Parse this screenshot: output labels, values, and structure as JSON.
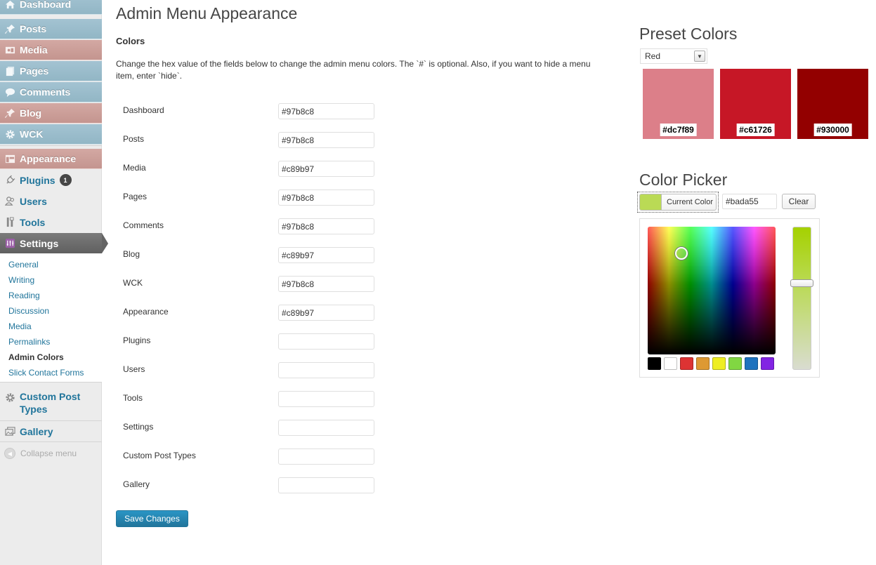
{
  "sidebar": {
    "items": [
      {
        "label": "Dashboard",
        "icon": "home-icon",
        "color": "#97b8c8"
      },
      {
        "label": "Posts",
        "icon": "pushpin-icon",
        "color": "#97b8c8"
      },
      {
        "label": "Media",
        "icon": "media-icon",
        "color": "#c89b97"
      },
      {
        "label": "Pages",
        "icon": "pages-icon",
        "color": "#97b8c8"
      },
      {
        "label": "Comments",
        "icon": "comment-icon",
        "color": "#97b8c8"
      },
      {
        "label": "Blog",
        "icon": "pushpin-icon",
        "color": "#c89b97"
      },
      {
        "label": "WCK",
        "icon": "gear-icon",
        "color": "#97b8c8"
      },
      {
        "label": "Appearance",
        "icon": "appearance-icon",
        "color": "#c89b97"
      },
      {
        "label": "Plugins",
        "icon": "plug-icon",
        "badge": "1"
      },
      {
        "label": "Users",
        "icon": "users-icon"
      },
      {
        "label": "Tools",
        "icon": "tools-icon"
      },
      {
        "label": "Settings",
        "icon": "settings-icon"
      },
      {
        "label": "Custom Post Types",
        "icon": "gear-icon"
      },
      {
        "label": "Gallery",
        "icon": "gallery-icon"
      }
    ],
    "submenu": [
      "General",
      "Writing",
      "Reading",
      "Discussion",
      "Media",
      "Permalinks",
      "Admin Colors",
      "Slick Contact Forms"
    ],
    "collapse_label": "Collapse menu"
  },
  "main": {
    "title": "Admin Menu Appearance",
    "section_title": "Colors",
    "description": "Change the hex value of the fields below to change the admin menu colors. The `#` is optional. Also, if you want to hide a menu item, enter `hide`.",
    "fields": [
      {
        "label": "Dashboard",
        "value": "#97b8c8"
      },
      {
        "label": "Posts",
        "value": "#97b8c8"
      },
      {
        "label": "Media",
        "value": "#c89b97"
      },
      {
        "label": "Pages",
        "value": "#97b8c8"
      },
      {
        "label": "Comments",
        "value": "#97b8c8"
      },
      {
        "label": "Blog",
        "value": "#c89b97"
      },
      {
        "label": "WCK",
        "value": "#97b8c8"
      },
      {
        "label": "Appearance",
        "value": "#c89b97"
      },
      {
        "label": "Plugins",
        "value": ""
      },
      {
        "label": "Users",
        "value": ""
      },
      {
        "label": "Tools",
        "value": ""
      },
      {
        "label": "Settings",
        "value": ""
      },
      {
        "label": "Custom Post Types",
        "value": ""
      },
      {
        "label": "Gallery",
        "value": ""
      }
    ],
    "save_label": "Save Changes"
  },
  "presets": {
    "title": "Preset Colors",
    "selected": "Red",
    "swatches": [
      "#dc7f89",
      "#c61726",
      "#930000"
    ]
  },
  "picker": {
    "title": "Color Picker",
    "current_color_label": "Current Color",
    "hex_value": "#bada55",
    "clear_label": "Clear",
    "palette": [
      "#000000",
      "#ffffff",
      "#dd3333",
      "#dd9933",
      "#eeee22",
      "#81d742",
      "#1e73be",
      "#8224e3"
    ]
  },
  "colors": {
    "link": "#21759b",
    "primary_button": "#21759b"
  }
}
